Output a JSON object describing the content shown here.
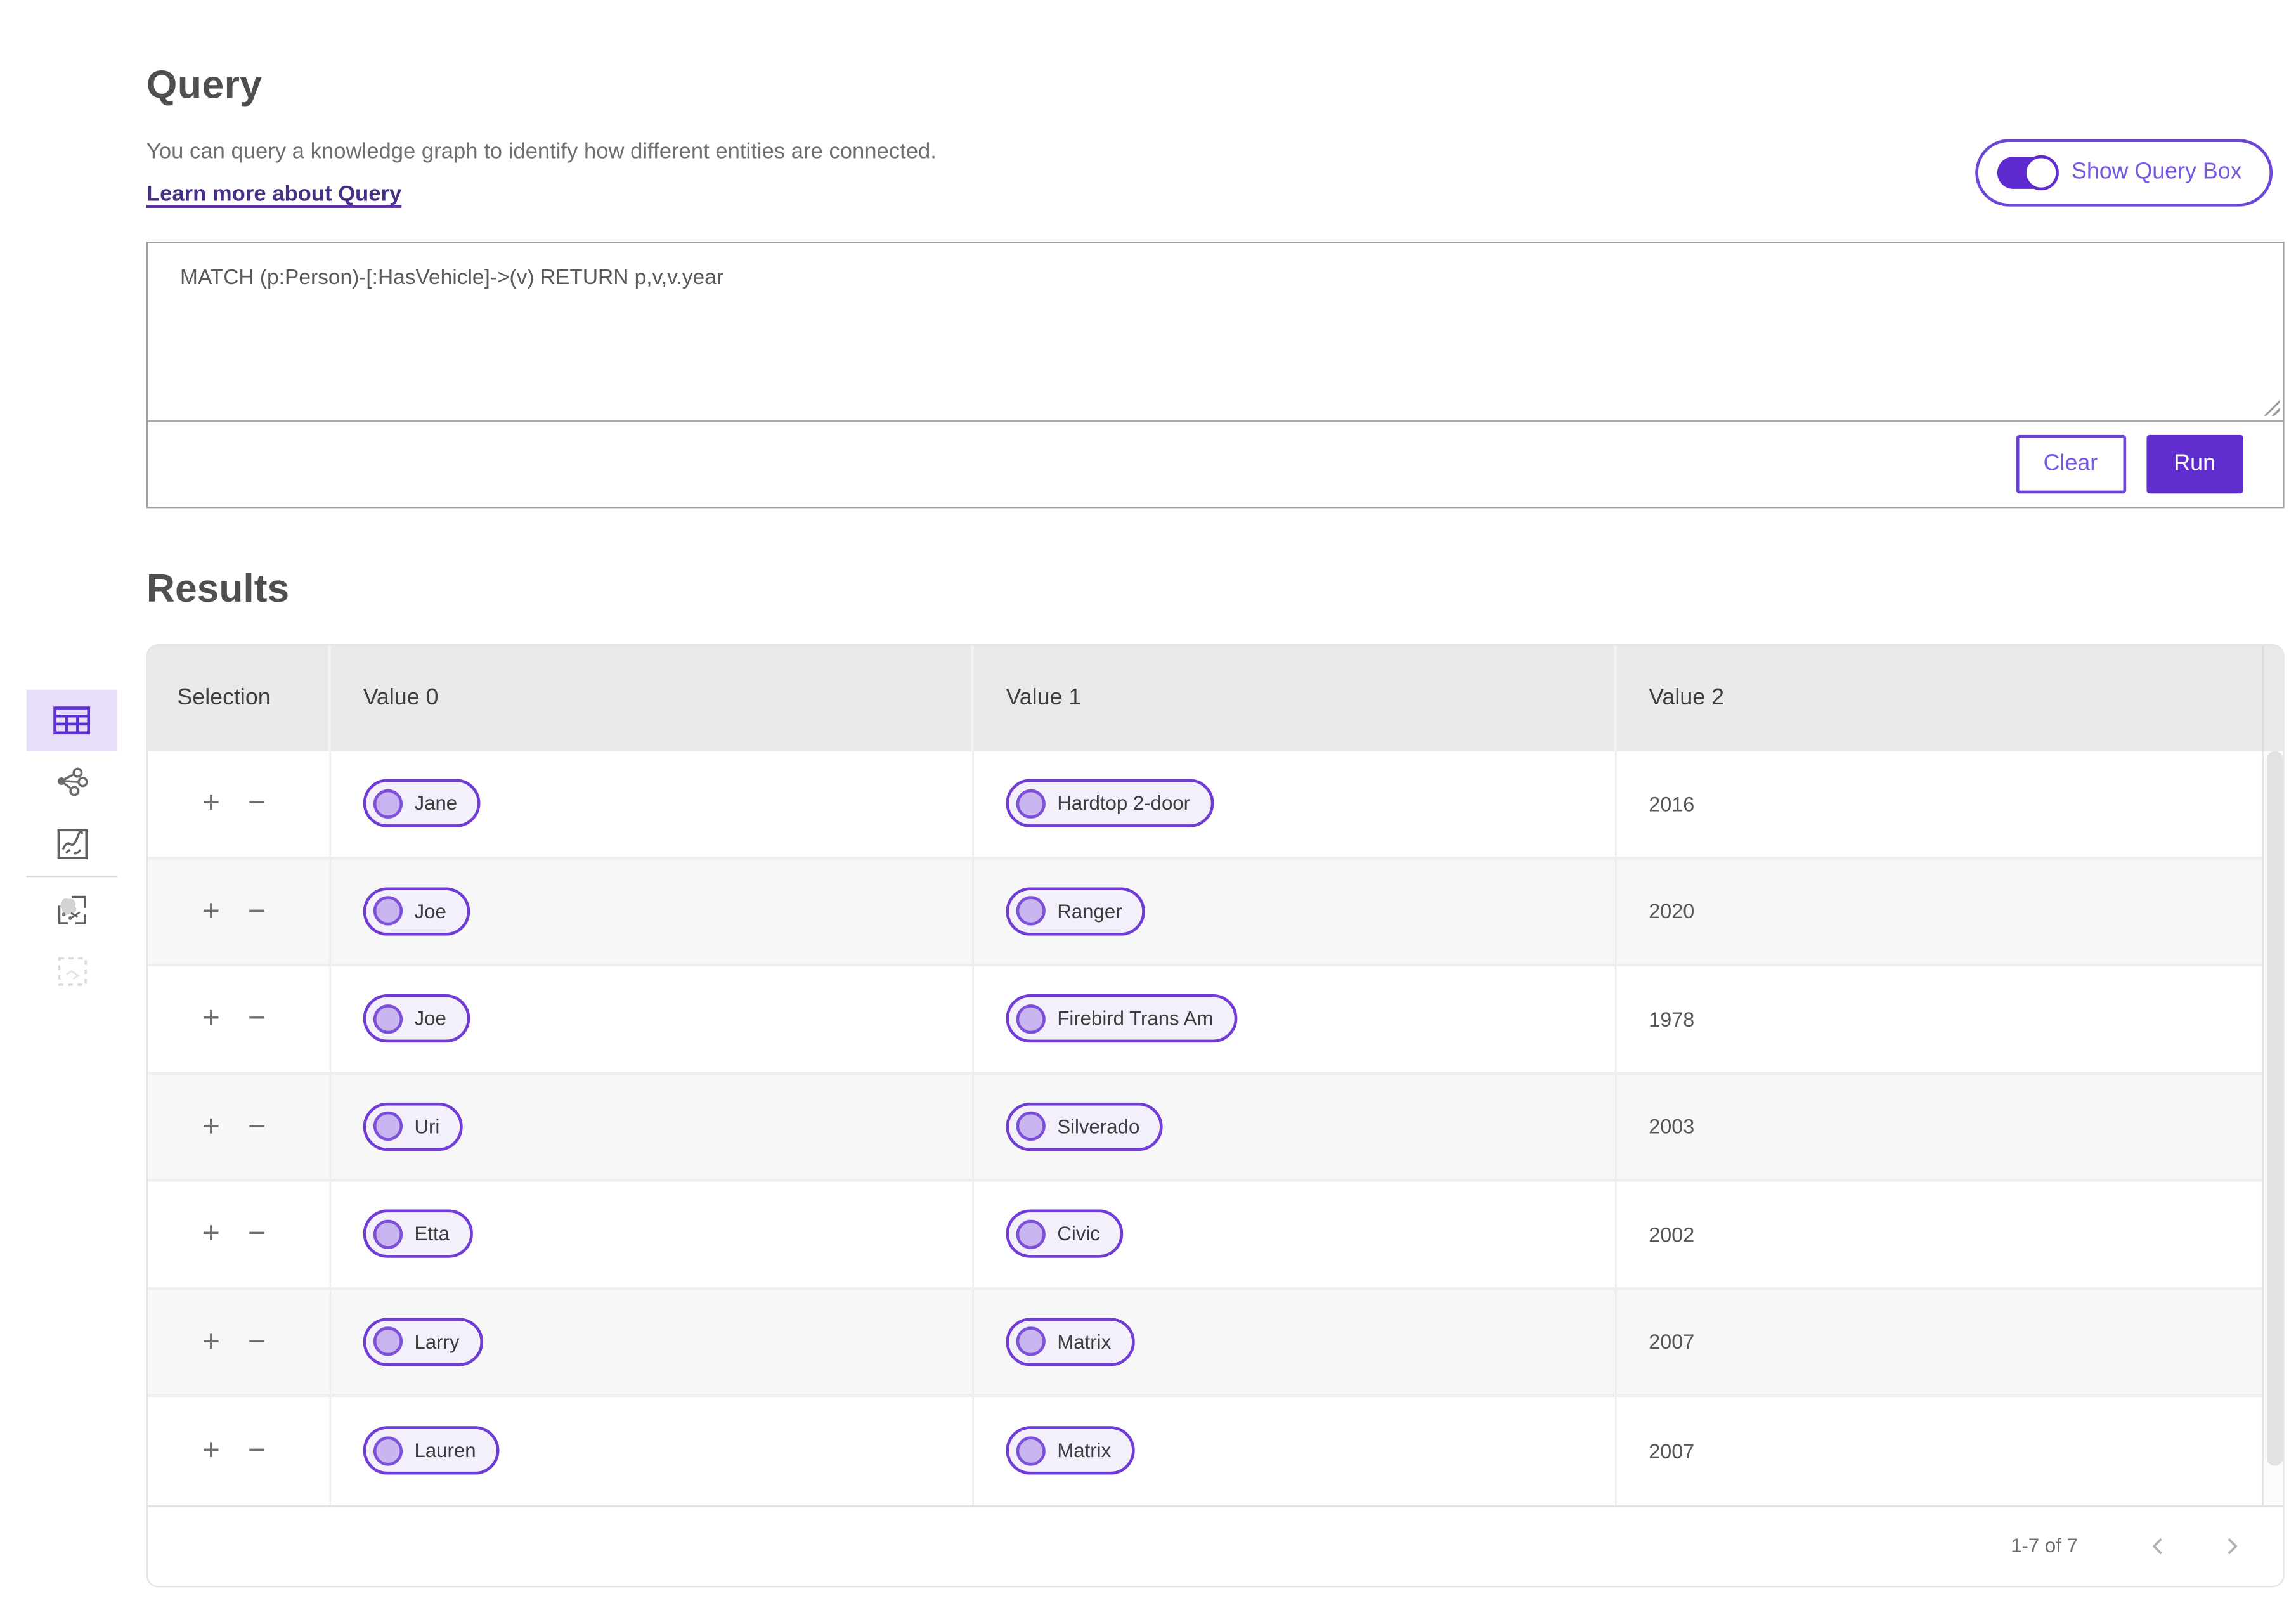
{
  "header": {
    "title": "Query",
    "description": "You can query a knowledge graph to identify how different entities are connected.",
    "learn_more_link": "Learn more about Query",
    "show_query_toggle": {
      "label": "Show Query Box",
      "state": "on"
    }
  },
  "query_editor": {
    "query_text": "MATCH (p:Person)-[:HasVehicle]->(v) RETURN p,v,v.year",
    "clear_button": "Clear",
    "run_button": "Run"
  },
  "results": {
    "title": "Results",
    "view_switcher": [
      {
        "name": "table-view",
        "icon": "table-icon",
        "active": true
      },
      {
        "name": "graph-view",
        "icon": "graph-icon",
        "active": false
      },
      {
        "name": "chart-view",
        "icon": "chart-icon",
        "active": false
      },
      {
        "name": "map-view",
        "icon": "map-icon",
        "active": false
      },
      {
        "name": "selection-view",
        "icon": "dashed-box-icon",
        "active": false,
        "disabled": true
      }
    ],
    "table": {
      "columns": [
        "Selection",
        "Value 0",
        "Value 1",
        "Value 2"
      ],
      "row_actions": {
        "add": "+",
        "remove": "−"
      },
      "rows": [
        {
          "value0": "Jane",
          "value1": "Hardtop 2-door",
          "value2": "2016"
        },
        {
          "value0": "Joe",
          "value1": "Ranger",
          "value2": "2020"
        },
        {
          "value0": "Joe",
          "value1": "Firebird Trans Am",
          "value2": "1978"
        },
        {
          "value0": "Uri",
          "value1": "Silverado",
          "value2": "2003"
        },
        {
          "value0": "Etta",
          "value1": "Civic",
          "value2": "2002"
        },
        {
          "value0": "Larry",
          "value1": "Matrix",
          "value2": "2007"
        },
        {
          "value0": "Lauren",
          "value1": "Matrix",
          "value2": "2007"
        }
      ]
    },
    "pagination": {
      "range_label": "1-7 of 7"
    }
  },
  "colors": {
    "accent_purple": "#6b46d8",
    "accent_dark": "#5f2ccd",
    "link_purple": "#462d85",
    "pill_bg": "#f3f0fb",
    "pill_node_fill": "#c9b5ef",
    "active_tile_bg": "#e7def9",
    "header_bg": "#e9e9e9",
    "row_alt_bg": "#f7f7f7"
  }
}
